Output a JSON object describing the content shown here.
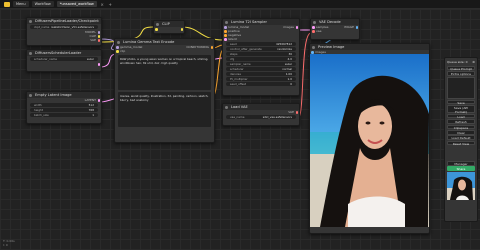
{
  "topbar": {
    "menu_label": "Menu",
    "tab_workflow": "Workflow",
    "tab_name": "*unsaved_workflow"
  },
  "nodes": {
    "checkpoint": {
      "title": "DiffusersPipelineLoader/Checkpoint",
      "widget_name": "ckpt_name",
      "widget_value": "realisticVision_v51.safetensors",
      "outputs": [
        "MODEL",
        "CLIP",
        "VAE"
      ]
    },
    "scheduler": {
      "title": "DiffusersSchedulerLoader",
      "widget_name": "scheduler_name",
      "widget_value": "euler"
    },
    "empty_latent": {
      "title": "Empty Latent Image",
      "output": "LATENT",
      "widgets": [
        {
          "name": "width",
          "value": "512"
        },
        {
          "name": "height",
          "value": "768"
        },
        {
          "name": "batch_size",
          "value": "1"
        }
      ]
    },
    "clip": {
      "title": "CLIP",
      "inputs": [
        "CLIP",
        "pipeline"
      ]
    },
    "prompt": {
      "title": "Lumina Gemma Text Encode",
      "inputs": [
        "gemma_model",
        "clip"
      ],
      "output": "CONDITIONING",
      "positive_text": "RAW photo, a young asian woman on a tropical beach, smiling, windblown hair, 8k uhd, dslr, high quality",
      "negative_text": "lowres, worst quality, illustration, 3d, painting, cartoon, sketch, blurry, bad anatomy"
    },
    "sampler": {
      "title": "Lumina T2I Sampler",
      "inputs": [
        "lumina_model",
        "positive",
        "negative",
        "latent"
      ],
      "output": "images",
      "widgets": [
        {
          "name": "seed",
          "value": "425067812"
        },
        {
          "name": "control_after_generate",
          "value": "randomize"
        },
        {
          "name": "steps",
          "value": "30"
        },
        {
          "name": "cfg",
          "value": "4.0"
        },
        {
          "name": "sampler_name",
          "value": "euler"
        },
        {
          "name": "scheduler",
          "value": "normal"
        },
        {
          "name": "denoise",
          "value": "1.00"
        },
        {
          "name": "t5_multiplier",
          "value": "1.0"
        },
        {
          "name": "seed_offset",
          "value": "0"
        }
      ]
    },
    "load_vae": {
      "title": "Load VAE",
      "output": "VAE",
      "widget_name": "vae_name",
      "widget_value": "sdxl_vae.safetensors"
    },
    "vae_decode": {
      "title": "VAE Decode",
      "inputs": [
        "samples",
        "vae"
      ],
      "output": "IMAGE"
    },
    "preview": {
      "title": "Preview Image",
      "input": "images"
    }
  },
  "side_menu": {
    "queue_size_label": "Queue size: 0",
    "settings_icon": "gear-icon",
    "queue_prompt": "Queue Prompt",
    "extra_options": "Extra options",
    "buttons": [
      "Save",
      "Save (API Format)",
      "Load",
      "Refresh",
      "Clipspace",
      "Clear",
      "Load Default",
      "Reset View"
    ],
    "manager": "Manager",
    "share": "Share"
  },
  "bottom_left": {
    "line1": "T: 0.00s",
    "line2": "I: 0"
  },
  "colors": {
    "model": "#b39ddb",
    "clip": "#f5e046",
    "vae": "#ff6e6e",
    "latent": "#ff9cf9",
    "conditioning": "#ffa931",
    "image": "#64b5f6"
  }
}
